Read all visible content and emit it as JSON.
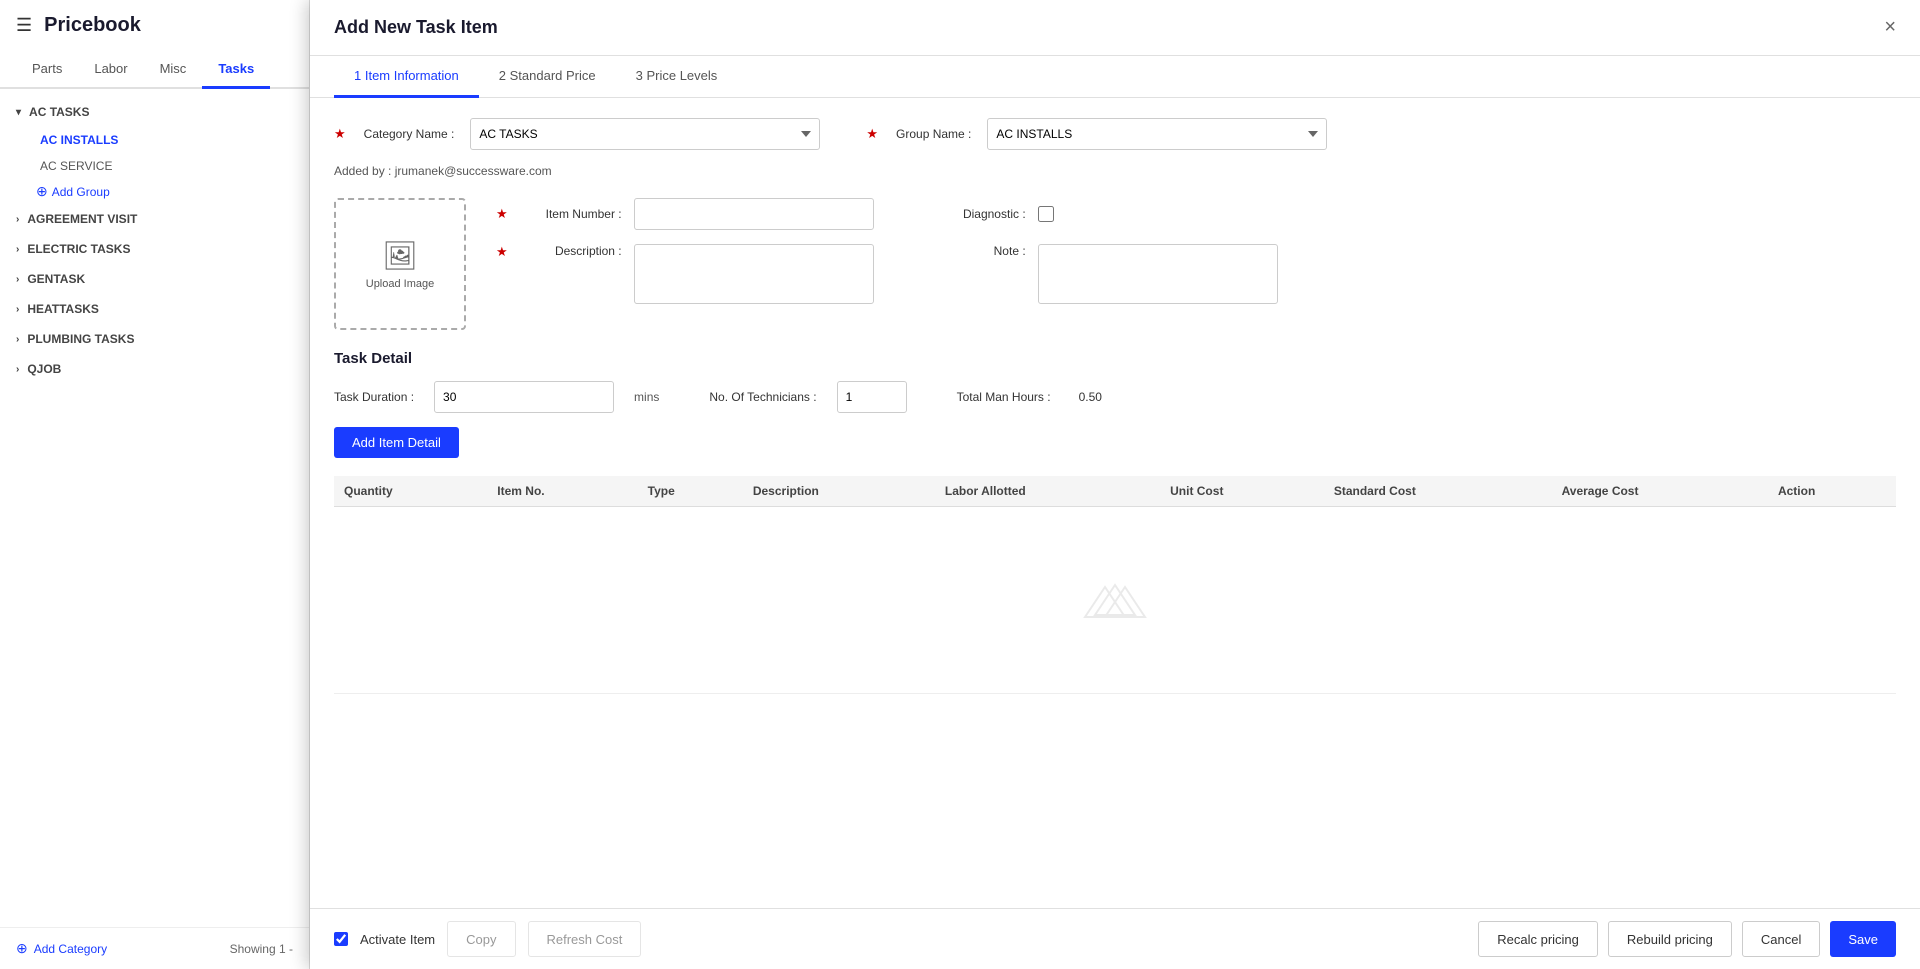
{
  "app": {
    "title": "Pricebook",
    "hamburger": "☰"
  },
  "top_tabs": [
    {
      "label": "Parts",
      "active": false
    },
    {
      "label": "Labor",
      "active": false
    },
    {
      "label": "Misc",
      "active": false
    },
    {
      "label": "Tasks",
      "active": true
    }
  ],
  "sidebar": {
    "categories": [
      {
        "label": "AC TASKS",
        "expanded": true,
        "groups": [
          {
            "label": "AC INSTALLS",
            "active": true
          },
          {
            "label": "AC SERVICE",
            "active": false
          }
        ],
        "add_group_label": "Add Group"
      },
      {
        "label": "AGREEMENT VISIT",
        "expanded": false,
        "groups": []
      },
      {
        "label": "ELECTRIC TASKS",
        "expanded": false,
        "groups": []
      },
      {
        "label": "GENTASK",
        "expanded": false,
        "groups": []
      },
      {
        "label": "HEATTASKS",
        "expanded": false,
        "groups": []
      },
      {
        "label": "PLUMBING TASKS",
        "expanded": false,
        "groups": []
      },
      {
        "label": "QJOB",
        "expanded": false,
        "groups": []
      }
    ],
    "add_category_label": "Add Category",
    "showing_text": "Showing 1 -"
  },
  "main": {
    "section_title": "AC TASKS"
  },
  "modal": {
    "title": "Add New Task Item",
    "close": "×",
    "wizard_tabs": [
      {
        "label": "1 Item Information",
        "active": true
      },
      {
        "label": "2 Standard Price",
        "active": false
      },
      {
        "label": "3 Price Levels",
        "active": false
      }
    ],
    "category_label": "Category Name :",
    "category_required": "★",
    "category_options": [
      "AC TASKS"
    ],
    "category_value": "AC TASKS",
    "group_label": "Group Name :",
    "group_required": "★",
    "group_options": [
      "AC INSTALLS"
    ],
    "group_value": "AC INSTALLS",
    "added_by_prefix": "Added by :",
    "added_by": "jrumanek@successware.com",
    "upload_label": "Upload Image",
    "item_number_label": "Item Number :",
    "item_number_required": "★",
    "item_number_value": "",
    "diagnostic_label": "Diagnostic :",
    "description_label": "Description :",
    "description_required": "★",
    "description_value": "",
    "note_label": "Note :",
    "note_value": "",
    "task_detail_title": "Task Detail",
    "task_duration_label": "Task Duration :",
    "task_duration_value": "30",
    "mins_label": "mins",
    "no_of_tech_label": "No. Of Technicians :",
    "no_of_tech_value": "1",
    "total_man_hours_label": "Total Man Hours :",
    "total_man_hours_value": "0.50",
    "add_item_detail_label": "Add Item Detail",
    "table_headers": [
      "Quantity",
      "Item No.",
      "Type",
      "Description",
      "Labor Allotted",
      "Unit Cost",
      "Standard Cost",
      "Average Cost",
      "Action"
    ],
    "footer": {
      "activate_item_label": "Activate Item",
      "activate_checked": true,
      "copy_label": "Copy",
      "refresh_cost_label": "Refresh Cost",
      "recalc_pricing_label": "Recalc pricing",
      "rebuild_pricing_label": "Rebuild pricing",
      "cancel_label": "Cancel",
      "save_label": "Save"
    }
  }
}
